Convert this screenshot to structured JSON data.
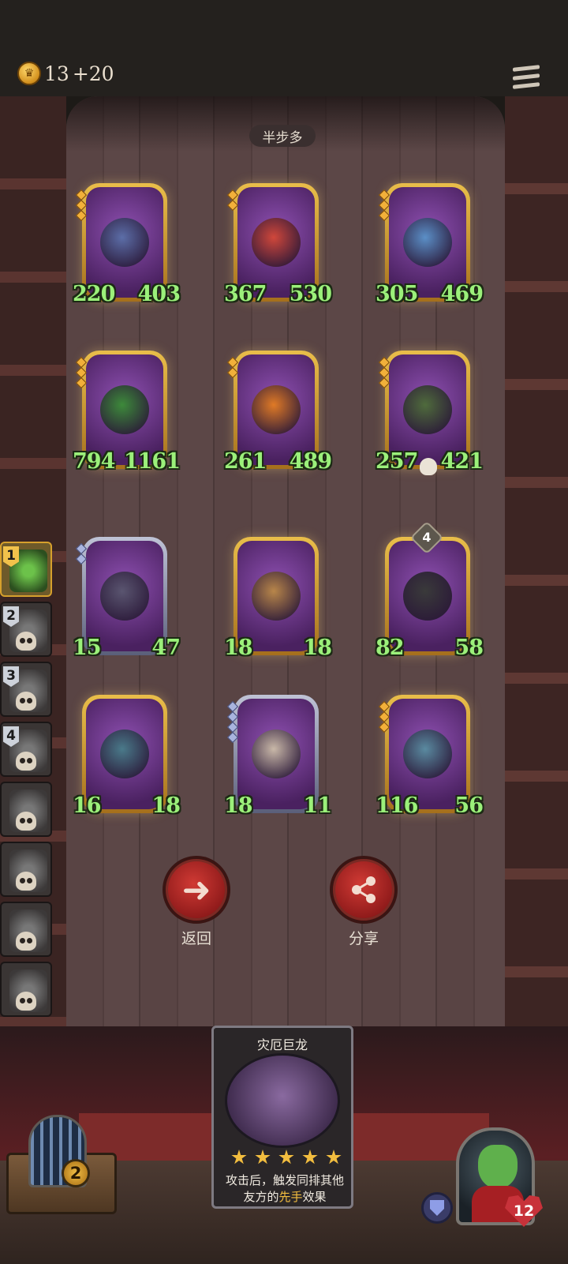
{
  "resources": {
    "gold": "13",
    "gold_income": "+20"
  },
  "board": {
    "title": "半步多"
  },
  "cards": [
    {
      "attack": "220",
      "health": "403",
      "tier": "gold",
      "pips": 3,
      "hue": "#5c6ea8"
    },
    {
      "attack": "367",
      "health": "530",
      "tier": "gold",
      "pips": 2,
      "hue": "#d0473b"
    },
    {
      "attack": "305",
      "health": "469",
      "tier": "gold",
      "pips": 3,
      "hue": "#5b8fc7"
    },
    {
      "attack": "794",
      "health": "1161",
      "tier": "gold",
      "pips": 3,
      "hue": "#3d8a3a"
    },
    {
      "attack": "261",
      "health": "489",
      "tier": "gold",
      "pips": 2,
      "hue": "#e07a26"
    },
    {
      "attack": "257",
      "health": "421",
      "tier": "gold",
      "pips": 3,
      "hue": "#4f6b3c",
      "skull": true
    },
    {
      "attack": "15",
      "health": "47",
      "tier": "silver",
      "pips": 2,
      "hue": "#5a5570"
    },
    {
      "attack": "18",
      "health": "18",
      "tier": "gold",
      "pips": 0,
      "hue": "#b8864a"
    },
    {
      "attack": "82",
      "health": "58",
      "tier": "gold",
      "pips": 0,
      "hue": "#3a3a3a",
      "level": "4"
    },
    {
      "attack": "16",
      "health": "18",
      "tier": "gold",
      "pips": 0,
      "hue": "#4a7a8a"
    },
    {
      "attack": "18",
      "health": "11",
      "tier": "silver",
      "pips": 4,
      "hue": "#c9b8a8"
    },
    {
      "attack": "116",
      "health": "56",
      "tier": "gold",
      "pips": 3,
      "hue": "#5a8aa0"
    }
  ],
  "players": [
    {
      "rank": "1",
      "active": true,
      "eliminated": false
    },
    {
      "rank": "2",
      "active": false,
      "eliminated": true
    },
    {
      "rank": "3",
      "active": false,
      "eliminated": true
    },
    {
      "rank": "4",
      "active": false,
      "eliminated": true
    },
    {
      "rank": "",
      "active": false,
      "eliminated": true
    },
    {
      "rank": "",
      "active": false,
      "eliminated": true
    },
    {
      "rank": "",
      "active": false,
      "eliminated": true
    },
    {
      "rank": "",
      "active": false,
      "eliminated": true
    }
  ],
  "actions": {
    "back_label": "返回",
    "share_label": "分享"
  },
  "skill_card": {
    "title": "灾厄巨龙",
    "stars": 5,
    "desc_before": "攻击后，触发同排其他友方的",
    "desc_highlight": "先手",
    "desc_after": "效果"
  },
  "cage_count": "2",
  "hero": {
    "health": "12"
  },
  "icons": {
    "gold": "crown-coin-icon",
    "menu": "menu-icon",
    "back": "arrow-left-icon",
    "share": "share-icon",
    "shield": "shield-icon",
    "health": "heart-icon"
  }
}
